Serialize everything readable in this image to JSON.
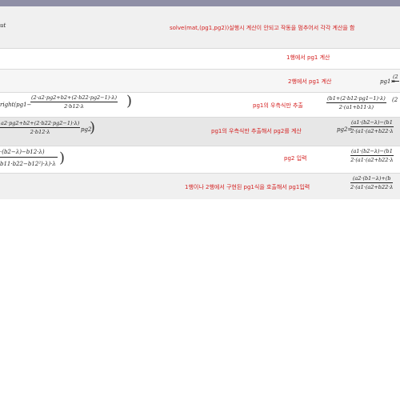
{
  "rows": {
    "r0": {
      "left_text": "ut",
      "note": "solve(mat,(pg1,pg2))실행시 계산이 안되고 작동을 멈추어서 각각 계산을 함"
    },
    "r1": {
      "note": "1행에서 pg1 계산"
    },
    "r2": {
      "note": "2행에서 pg1 계산",
      "right_lhs": "pg1=",
      "right_num": "(2",
      "right_den": ""
    },
    "r3": {
      "left_prefix": "right(pg1−",
      "left_num": "(2·a2·pg2+b2+(2·b22·pg2−1)·λ)",
      "left_den": "2·b12·λ",
      "note": "pg1의 우측식만 추출",
      "right_num": "(b1+(2·b12·pg1−1)·λ)",
      "right_num2": "(2",
      "right_den": "2·(a1+b11·λ)"
    },
    "r4": {
      "left_num": "a2·pg2+b2+(2·b22·pg2−1)·λ)",
      "left_den": "2·b12·λ",
      "left_suffix": "pg2",
      "note": "pg1의 우측식만 추출해서 pg2를 계산",
      "right_lhs": "pg2=",
      "right_num": "(a1·(b2−λ)−(b1",
      "right_den": "2·(a1·(a2+b22·λ"
    },
    "r5": {
      "left_line1": "·(b2−λ)−b12·λ)",
      "left_line2": "b11·b22−b12²)·λ)·λ",
      "note": "pg2 입력",
      "right_num": "(a1·(b2−λ)−(b1",
      "right_den": "2·(a1·(a2+b22·λ"
    },
    "r6": {
      "note": "1행이나 2행에서 구현된 pg1식을 호출해서 pg1입력",
      "right_num": "(a2·(b1−λ)+(b",
      "right_den": "2·(a1·(a2+b22·λ"
    }
  }
}
